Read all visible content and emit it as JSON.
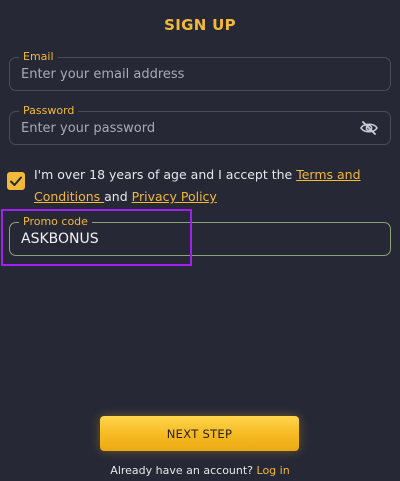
{
  "header": {
    "title": "SIGN UP"
  },
  "form": {
    "email": {
      "label": "Email",
      "placeholder": "Enter your email address",
      "value": ""
    },
    "password": {
      "label": "Password",
      "placeholder": "Enter your password",
      "value": "",
      "toggle_icon": "eye-slash-icon"
    },
    "terms": {
      "checked": true,
      "text_prefix": "I'm over 18 years of age and I accept the ",
      "terms_link": "Terms and Conditions ",
      "connector": "and ",
      "privacy_link": "Privacy Policy"
    },
    "promo": {
      "label": "Promo code",
      "value": "ASKBONUS",
      "placeholder": ""
    }
  },
  "actions": {
    "next_label": "NEXT STEP"
  },
  "footer": {
    "question": "Already have an account?",
    "login_link": "Log in"
  },
  "colors": {
    "background": "#262836",
    "accent": "#f2b93b",
    "highlight": "#a020f0"
  }
}
